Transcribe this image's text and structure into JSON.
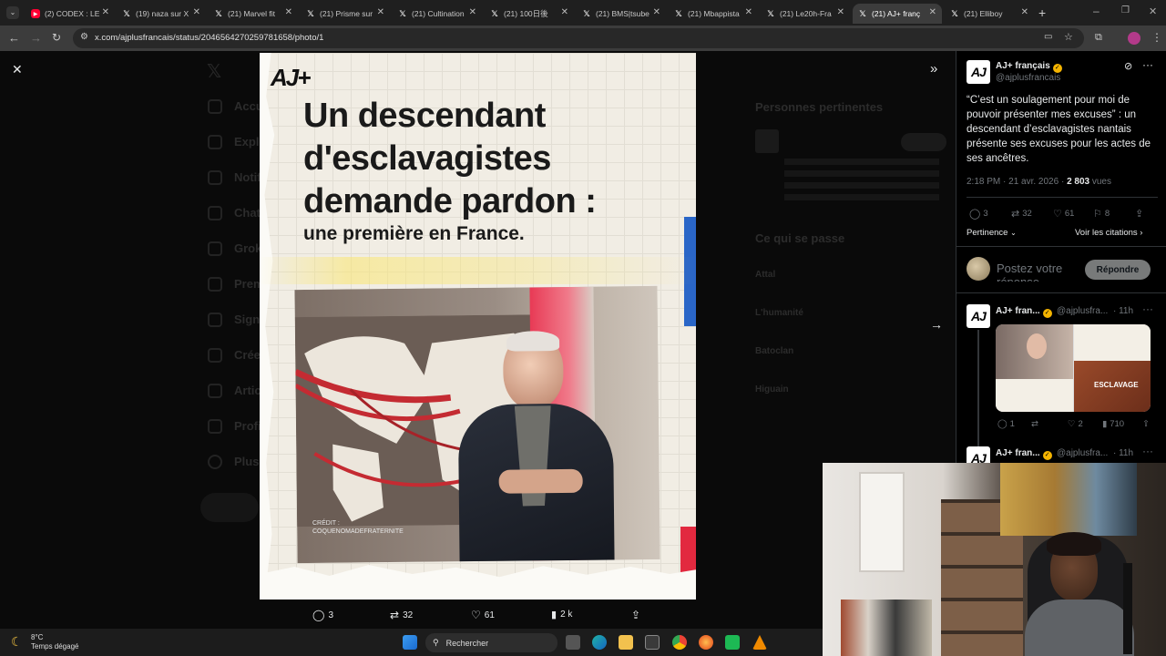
{
  "browser": {
    "tabs": [
      {
        "label": "(2) CODEX : LE",
        "favicon": "youtube-icon",
        "color": "#ff0033",
        "active": false
      },
      {
        "label": "(19) naza sur X",
        "favicon": "x-icon",
        "active": false
      },
      {
        "label": "(21) Marvel fit",
        "favicon": "x-icon",
        "active": false
      },
      {
        "label": "(21) Prisme sur",
        "favicon": "x-icon",
        "active": false
      },
      {
        "label": "(21) Cultination",
        "favicon": "x-icon",
        "active": false
      },
      {
        "label": "(21) 100日後",
        "favicon": "x-icon",
        "active": false
      },
      {
        "label": "(21) BMS|tsube",
        "favicon": "x-icon",
        "active": false
      },
      {
        "label": "(21) Mbappista",
        "favicon": "x-icon",
        "active": false
      },
      {
        "label": "(21) Le20h-Fra",
        "favicon": "x-icon",
        "active": false
      },
      {
        "label": "(21) AJ+ franç",
        "favicon": "x-icon",
        "active": true
      },
      {
        "label": "(21) Elliboy",
        "favicon": "x-icon",
        "active": false
      }
    ],
    "url": "x.com/ajplusfrancais/status/2046564270259781658/photo/1"
  },
  "background_page": {
    "nav_items": [
      "Accueil",
      "Explorer",
      "Notifications",
      "Chat",
      "Grok",
      "Premium",
      "Signets",
      "Créer",
      "Articles",
      "Profil",
      "Plus"
    ],
    "relevant_people_title": "Personnes pertinentes",
    "happening_title": "Ce qui se passe",
    "happening_items": [
      "Attal",
      "L'humanité",
      "Batoclan",
      "Higuain"
    ]
  },
  "media": {
    "logo": "AJ+",
    "headline_lines": [
      "Un descendant",
      "d'esclavagistes",
      "demande pardon :"
    ],
    "subline": "une première en France.",
    "credit_lines": [
      "CRÉDIT :",
      "COQUENOMADEFRATERNITE"
    ],
    "actions": {
      "replies": "3",
      "reposts": "32",
      "likes": "61",
      "views": "2 k"
    }
  },
  "tweet": {
    "author": "AJ+ français",
    "handle": "@ajplusfrancais",
    "text": "“C’est un soulagement pour moi de pouvoir présenter mes excuses” : un descendant d’esclavagistes nantais présente ses excuses pour les actes de ses ancêtres.",
    "time": "2:18 PM · 21 avr. 2026 · ",
    "views_number": "2 803",
    "views_label": " vues",
    "stats": {
      "replies": "3",
      "reposts": "32",
      "likes": "61",
      "bookmarks": "8"
    },
    "sort_label": "Pertinence",
    "quotes_label": "Voir les citations",
    "reply_placeholder": "Postez votre réponse",
    "reply_button": "Répondre"
  },
  "thread": [
    {
      "author": "AJ+ fran...",
      "handle": "@ajplusfra...",
      "time": "· 11h",
      "thumb_word": "ESCLAVAGE",
      "stats": {
        "replies": "1",
        "reposts": "",
        "likes": "2",
        "views": "710"
      }
    },
    {
      "author": "AJ+ fran...",
      "handle": "@ajplusfra...",
      "time": "· 11h"
    }
  ],
  "taskbar": {
    "temp": "8°C",
    "weather": "Temps dégagé",
    "search": "Rechercher"
  }
}
